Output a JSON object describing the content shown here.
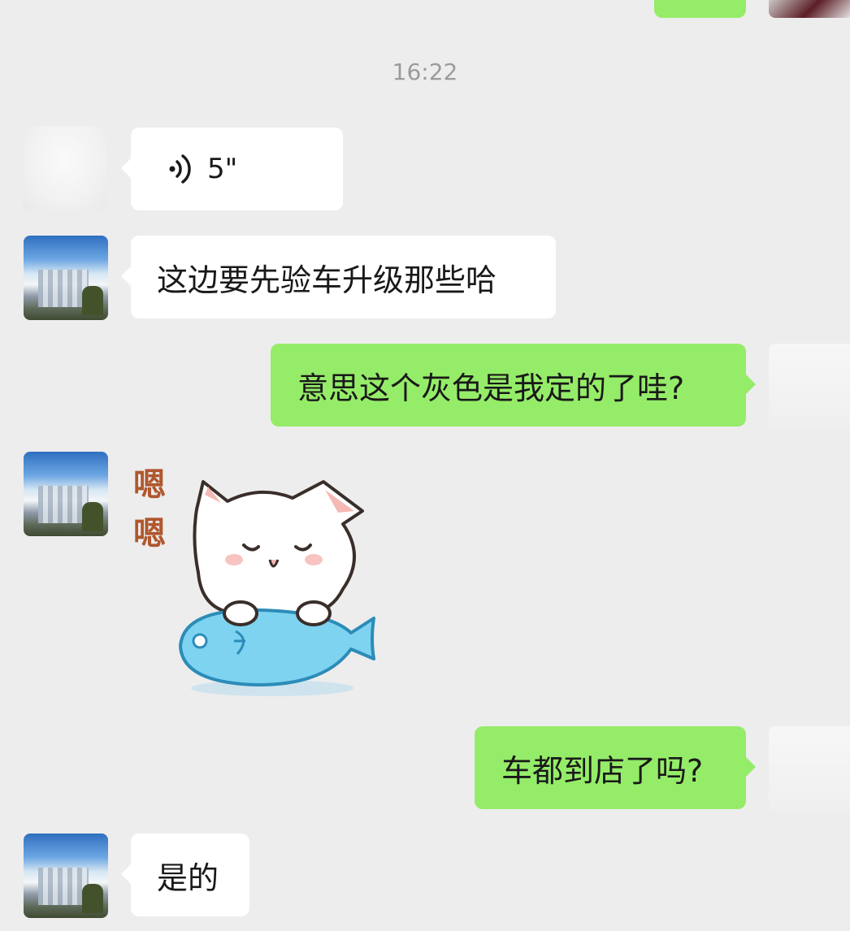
{
  "chat": {
    "timestamp": "16:22",
    "messages": [
      {
        "side": "left",
        "type": "voice",
        "duration": "5\"",
        "icon": "voice-waves-icon"
      },
      {
        "side": "left",
        "type": "text",
        "text": "这边要先验车升级那些哈"
      },
      {
        "side": "right",
        "type": "text",
        "text": "意思这个灰色是我定的了哇?"
      },
      {
        "side": "left",
        "type": "sticker",
        "sticker_text_1": "嗯",
        "sticker_text_2": "嗯",
        "sticker_name": "cat-on-fish-sticker"
      },
      {
        "side": "right",
        "type": "text",
        "text": "车都到店了吗?"
      },
      {
        "side": "left",
        "type": "text",
        "text": "是的"
      }
    ]
  },
  "colors": {
    "background": "#EDEDED",
    "incoming_bubble": "#FFFFFF",
    "outgoing_bubble": "#95EC69",
    "timestamp": "#9B9B9B"
  }
}
